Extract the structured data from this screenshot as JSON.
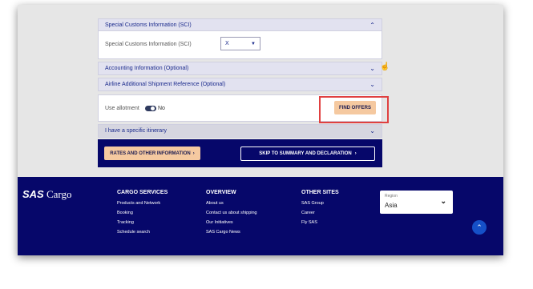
{
  "sci": {
    "title": "Special Customs Information (SCI)",
    "field_label": "Special Customs Information (SCI)",
    "field_value": "X"
  },
  "accounting": {
    "title": "Accounting Information (Optional)"
  },
  "airline_ref": {
    "title": "Airline Additional Shipment Reference (Optional)"
  },
  "allotment": {
    "label": "Use allotment",
    "value": "No"
  },
  "find_offers_label": "FIND OFFERS",
  "itinerary": {
    "title": "I have a specific itinerary"
  },
  "actions": {
    "rates_label": "RATES AND OTHER INFORMATION",
    "skip_label": "SKIP TO SUMMARY AND DECLARATION"
  },
  "footer": {
    "logo_brand": "SAS",
    "logo_text": "Cargo",
    "services": {
      "title": "CARGO SERVICES",
      "links": [
        "Products and Network",
        "Booking",
        "Tracking",
        "Schedule search"
      ]
    },
    "overview": {
      "title": "OVERVIEW",
      "links": [
        "About us",
        "Contact us about shipping",
        "Our Initiatives",
        "SAS Cargo News"
      ]
    },
    "other": {
      "title": "OTHER SITES",
      "links": [
        "SAS Group",
        "Career",
        "Fly SAS"
      ]
    },
    "region_label": "Region",
    "region_value": "Asia"
  },
  "icons": {
    "chevron": "chevron-icon",
    "caret": "caret-down-icon",
    "arrow_up": "arrow-up-icon",
    "arrow_right": "arrow-right-icon",
    "hand": "hand-pointer-icon"
  },
  "colors": {
    "navy": "#06076a",
    "accent": "#f5c9a0",
    "highlight": "#e04040",
    "button_blue": "#1550c8"
  }
}
